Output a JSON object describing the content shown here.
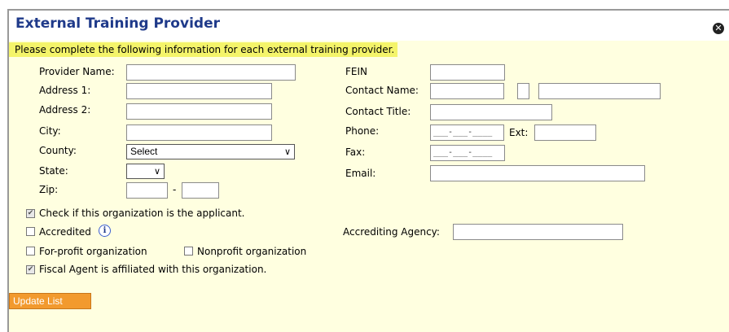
{
  "dialog": {
    "title": "External Training Provider",
    "instruction": "Please complete the following information for each external training provider.",
    "close_icon": "close-icon"
  },
  "left": {
    "provider_name_label": "Provider Name:",
    "address1_label": "Address 1:",
    "address2_label": "Address 2:",
    "city_label": "City:",
    "county_label": "County:",
    "county_value": "Select",
    "state_label": "State:",
    "state_value": "",
    "zip_label": "Zip:",
    "zip_sep": "-"
  },
  "right": {
    "fein_label": "FEIN",
    "contact_name_label": "Contact Name:",
    "contact_title_label": "Contact Title:",
    "phone_label": "Phone:",
    "phone_mask": "___-___-____",
    "ext_label": "Ext:",
    "fax_label": "Fax:",
    "fax_mask": "___-___-____",
    "email_label": "Email:"
  },
  "checks": {
    "applicant_label": "Check if this organization is the applicant.",
    "applicant_checked": true,
    "accredited_label": "Accredited",
    "accredited_checked": false,
    "accrediting_agency_label": "Accrediting Agency:",
    "forprofit_label": "For-profit organization",
    "forprofit_checked": false,
    "nonprofit_label": "Nonprofit organization",
    "nonprofit_checked": false,
    "fiscal_label": "Fiscal Agent is affiliated with this organization.",
    "fiscal_checked": true
  },
  "actions": {
    "update_label": "Update List"
  },
  "colors": {
    "background": "#ffffe0",
    "title": "#1f3a8a",
    "highlight": "#f4f46a",
    "button": "#f29a2e"
  }
}
